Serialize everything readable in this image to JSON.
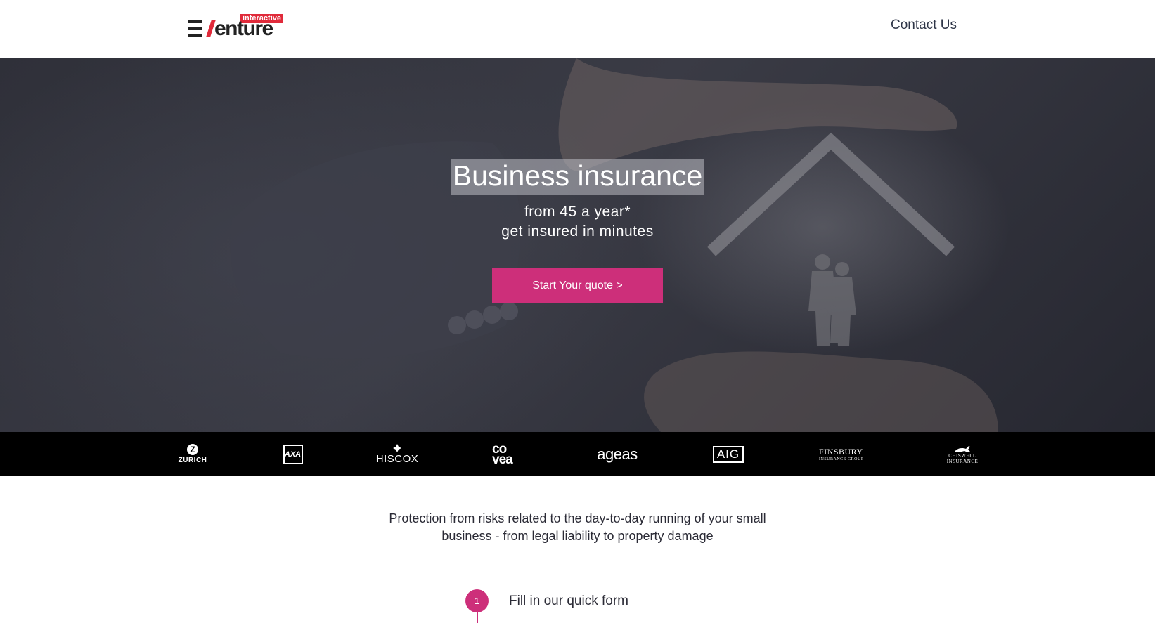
{
  "header": {
    "logo_tag": "interactive",
    "logo_text": "enture",
    "contact_label": "Contact Us"
  },
  "hero": {
    "title": "Business insurance",
    "subtitle_line1": "from 45 a year*",
    "subtitle_line2": "get insured in minutes",
    "cta_label": "Start Your quote >"
  },
  "partners": [
    {
      "name": "ZURICH",
      "icon": "zurich-logo"
    },
    {
      "name": "AXA",
      "icon": "axa-logo"
    },
    {
      "name": "HISCOX",
      "icon": "hiscox-logo"
    },
    {
      "name": "co vea",
      "icon": "covea-logo"
    },
    {
      "name": "ageas",
      "icon": "ageas-logo"
    },
    {
      "name": "AIG",
      "icon": "aig-logo"
    },
    {
      "name": "FINSBURY",
      "sub": "INSURANCE GROUP",
      "icon": "finsbury-logo"
    },
    {
      "name": "CHISWELL",
      "sub": "INSURANCE",
      "icon": "chiswell-logo"
    }
  ],
  "description": {
    "line1": "Protection from risks related to the day-to-day running of your small",
    "line2": "business - from legal liability to property damage"
  },
  "steps": [
    {
      "number": "1",
      "label": "Fill in our quick form"
    }
  ],
  "colors": {
    "accent": "#cd2f7a",
    "logo_red": "#e02a3a",
    "strip": "#000000"
  }
}
